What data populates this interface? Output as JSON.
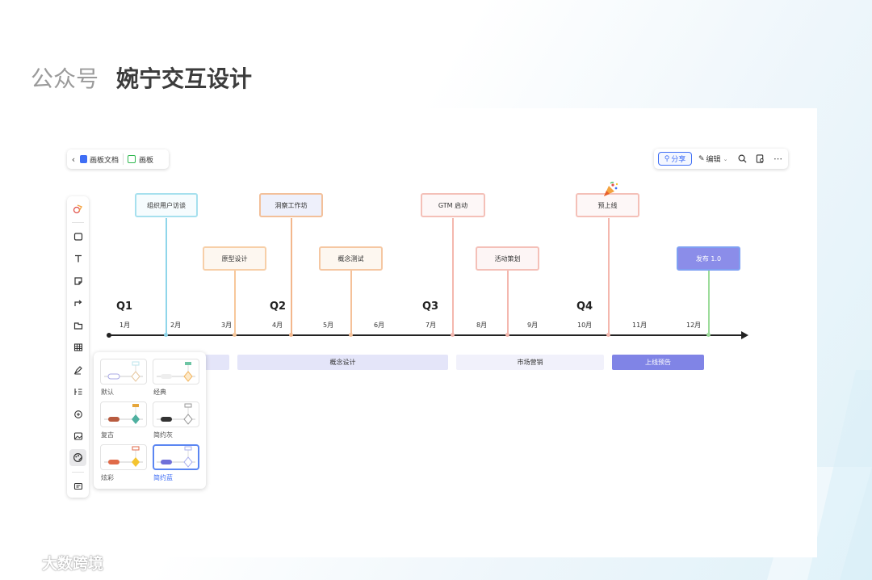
{
  "header": {
    "prefix": "公众号",
    "name": "婉宁交互设计"
  },
  "breadcrumb": {
    "doc_label": "画板文档",
    "board_label": "画板"
  },
  "topbar": {
    "share_label": "分享",
    "edit_label": "编辑"
  },
  "milestones": [
    {
      "label": "组织用户访谈",
      "color": "#8fd6ea",
      "fill": "#f4fbfd"
    },
    {
      "label": "原型设计",
      "color": "#f7c79b",
      "fill": "#fdf6ee"
    },
    {
      "label": "洞察工作坊",
      "color": "#f3b78c",
      "fill": "#eef0fb"
    },
    {
      "label": "概念测试",
      "color": "#f5c199",
      "fill": "#fdf6ee"
    },
    {
      "label": "GTM 启动",
      "color": "#f4b7ae",
      "fill": "#fdf6f6"
    },
    {
      "label": "活动策划",
      "color": "#f4b7ae",
      "fill": "#fdf4f4"
    },
    {
      "label": "预上线",
      "color": "#f4b7ae",
      "fill": "#fdf6f6"
    },
    {
      "label": "发布 1.0",
      "color": "#6f8cf0",
      "fill": "#8b8de9"
    }
  ],
  "quarters": [
    "Q1",
    "Q2",
    "Q3",
    "Q4"
  ],
  "months": [
    "1月",
    "2月",
    "3月",
    "4月",
    "5月",
    "6月",
    "7月",
    "8月",
    "9月",
    "10月",
    "11月",
    "12月"
  ],
  "phases": [
    "概念设计",
    "市场营销",
    "上线预告"
  ],
  "themes": [
    {
      "label": "默认"
    },
    {
      "label": "经典"
    },
    {
      "label": "复古"
    },
    {
      "label": "简约灰"
    },
    {
      "label": "炫彩"
    },
    {
      "label": "简约蓝"
    }
  ],
  "watermark": "大数跨境",
  "colors": {
    "accent": "#3f6ef5",
    "launch_fill": "#8084e6",
    "phase_fill": "#e4e5f9"
  }
}
